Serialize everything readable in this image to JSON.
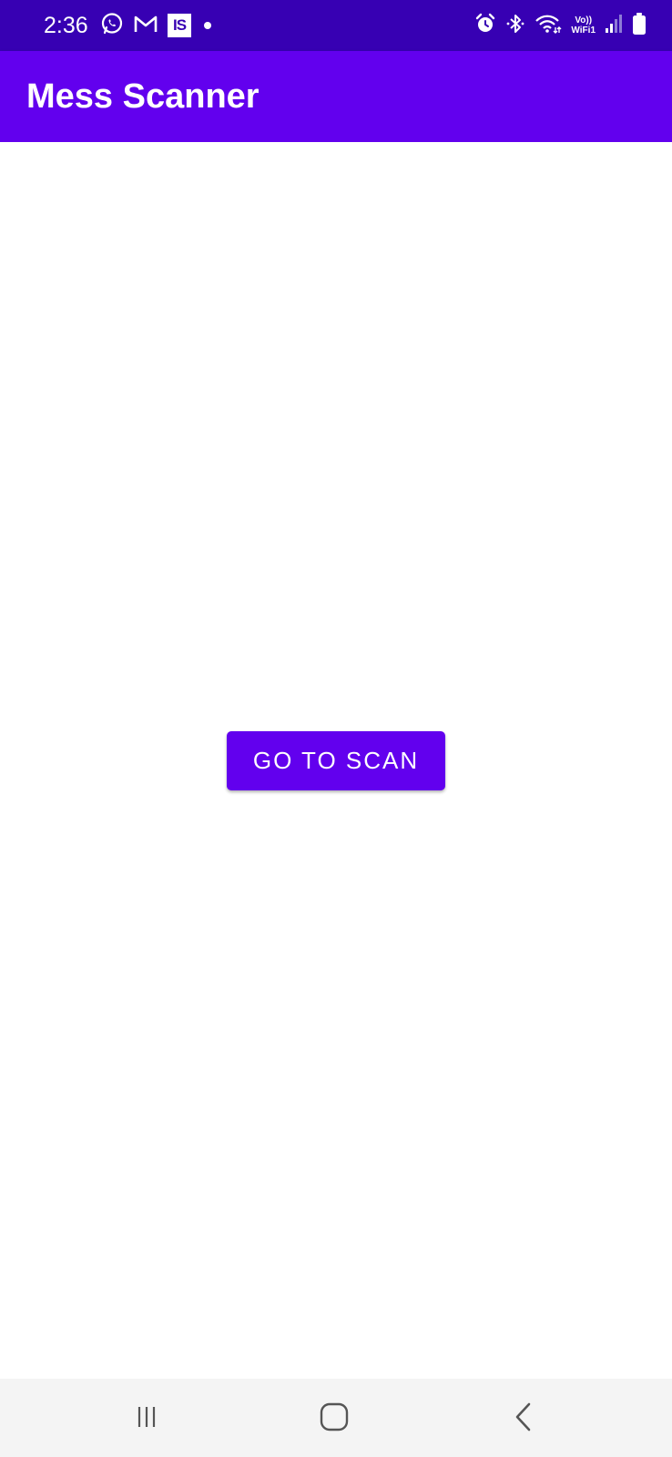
{
  "status_bar": {
    "time": "2:36",
    "left_icons": [
      "whatsapp-icon",
      "gmail-icon",
      "is-app-icon",
      "notification-dot-icon"
    ],
    "is_badge_text": "IS",
    "right_icons": [
      "alarm-icon",
      "bluetooth-icon",
      "wifi-icon",
      "volte-indicator",
      "signal-icon",
      "battery-icon"
    ],
    "volte_line1": "Vo))",
    "volte_line2": "WiFi1",
    "background_color": "#3700b3"
  },
  "app_bar": {
    "title": "Mess Scanner",
    "background_color": "#6200ee"
  },
  "main": {
    "scan_button_label": "GO TO SCAN",
    "button_color": "#6200ee"
  },
  "nav_bar": {
    "buttons": [
      "recent-apps-icon",
      "home-icon",
      "back-icon"
    ]
  }
}
